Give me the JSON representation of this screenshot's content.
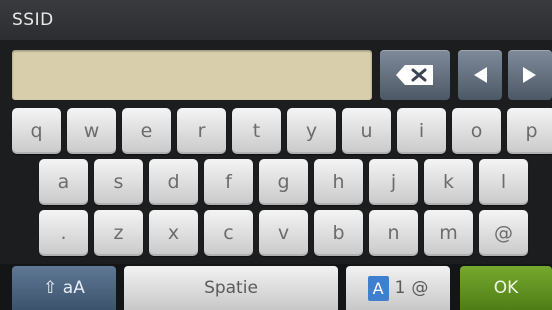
{
  "header": {
    "title": "SSID"
  },
  "input": {
    "value": ""
  },
  "controls": {
    "backspace_icon": "backspace-icon",
    "left_icon": "arrow-left-icon",
    "right_icon": "arrow-right-icon"
  },
  "keyboard": {
    "row1": [
      "q",
      "w",
      "e",
      "r",
      "t",
      "y",
      "u",
      "i",
      "o",
      "p"
    ],
    "row2": [
      "a",
      "s",
      "d",
      "f",
      "g",
      "h",
      "j",
      "k",
      "l"
    ],
    "row3": [
      ".",
      "z",
      "x",
      "c",
      "v",
      "b",
      "n",
      "m",
      "@"
    ]
  },
  "bottom": {
    "shift_label": "⇧ aA",
    "space_label": "Spatie",
    "mode_a": "A",
    "mode_1": "1",
    "mode_at": "@",
    "ok_label": "OK"
  },
  "colors": {
    "background": "#1c1d1f",
    "entry": "#d8ceab",
    "shift": "#4a6480",
    "ok": "#5f8f1f",
    "mode_highlight": "#3f7fd0"
  }
}
